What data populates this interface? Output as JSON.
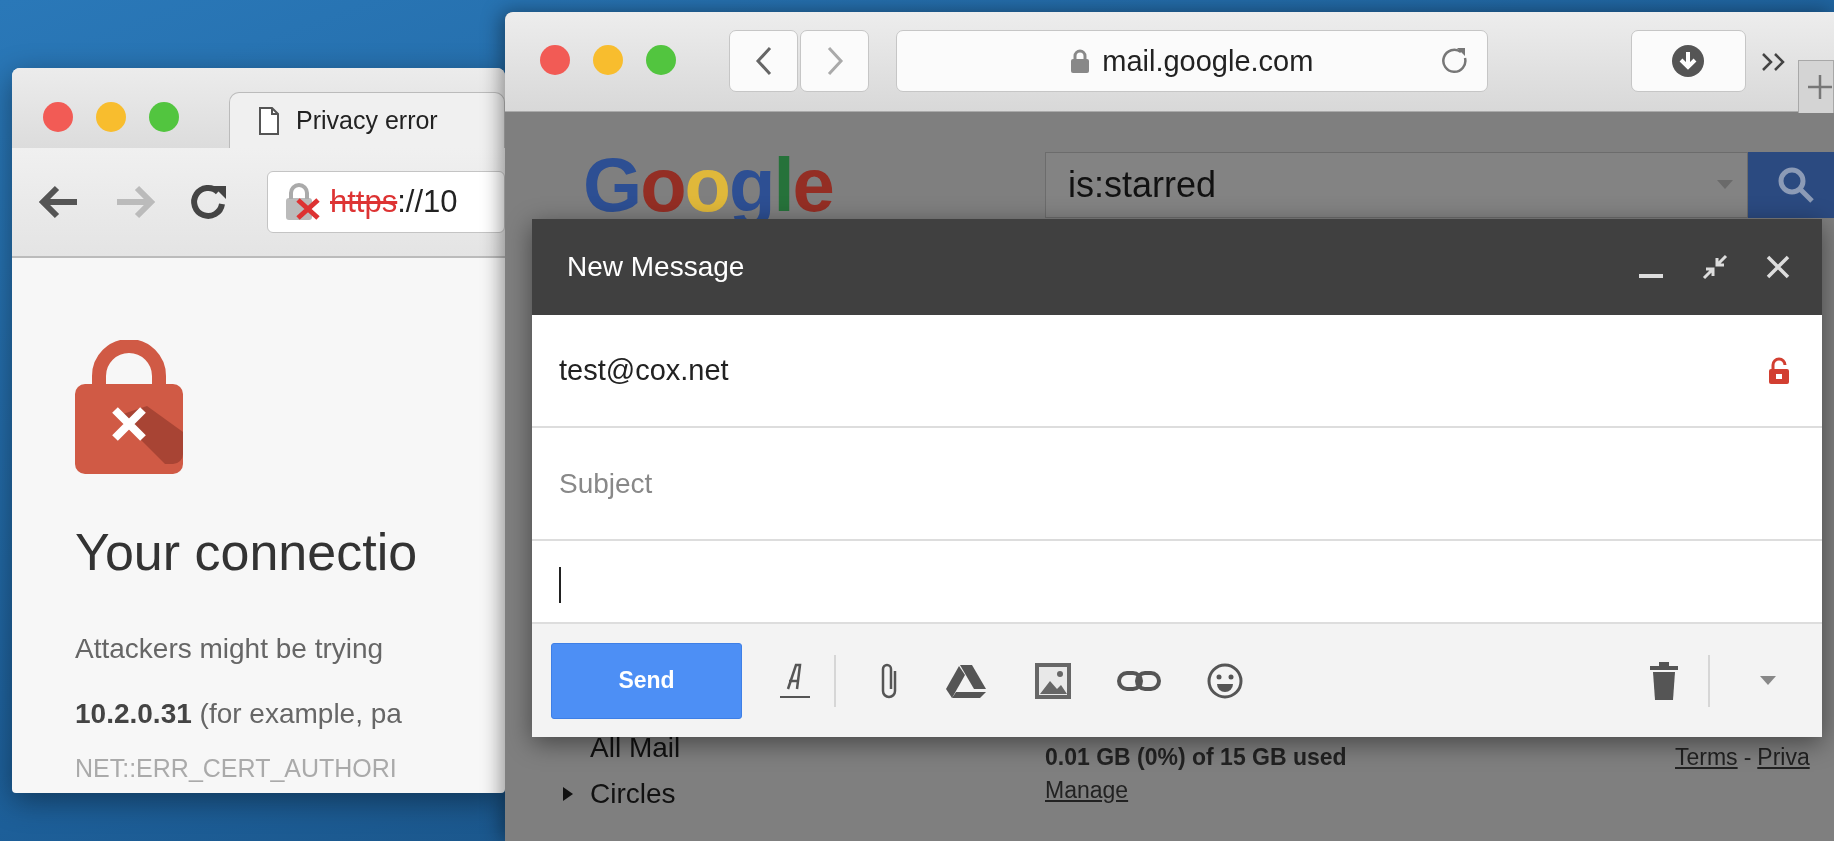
{
  "chrome_window": {
    "tab": {
      "title": "Privacy error",
      "selected": true
    },
    "nav": {
      "back_disabled": false,
      "forward_disabled": true
    },
    "address_bar": {
      "scheme": "https",
      "rest": "://10"
    },
    "page": {
      "heading": "Your connectio",
      "lines": [
        "Attackers might be trying",
        "**10.2.0.31** (for example, pa"
      ],
      "error_code": "NET::ERR_CERT_AUTHORI"
    }
  },
  "safari_window": {
    "address": "mail.google.com",
    "gmail": {
      "logo": "Google",
      "search": {
        "value": "is:starred"
      },
      "sidebar": [
        {
          "label": "All Mail",
          "kind": "item"
        },
        {
          "label": "Circles",
          "kind": "folder",
          "expanded": false
        }
      ],
      "storage": {
        "usage": "0.01 GB (0%) of 15 GB used",
        "manage_link": "Manage"
      },
      "footer": {
        "links": [
          "Terms",
          "Priva"
        ],
        "separator": "-"
      }
    },
    "compose": {
      "title": "New Message",
      "to": "test@cox.net",
      "recipient_secure": false,
      "subject_placeholder": "Subject",
      "send_button": "Send"
    }
  }
}
